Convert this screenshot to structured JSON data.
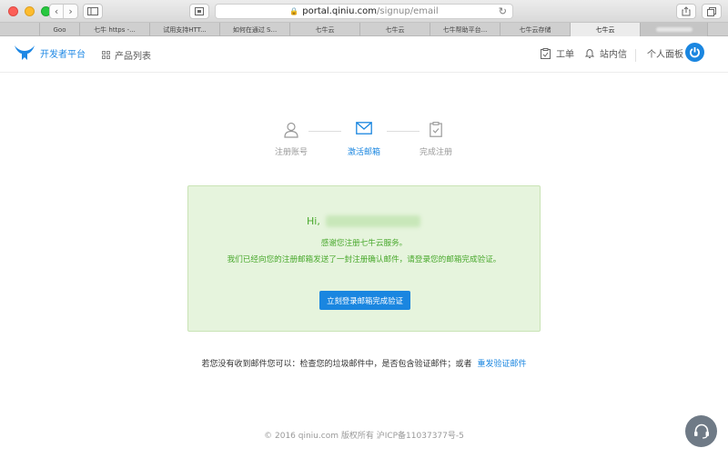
{
  "browser": {
    "url_host": "portal.qiniu.com",
    "url_path": "/signup/email",
    "tabs": [
      {
        "label": "Goo",
        "active": false
      },
      {
        "label": "七牛 https -...",
        "active": false
      },
      {
        "label": "试用支持HTT...",
        "active": false
      },
      {
        "label": "如何在通过 S...",
        "active": false
      },
      {
        "label": "七牛云",
        "active": false
      },
      {
        "label": "七牛云",
        "active": false
      },
      {
        "label": "七牛帮助平台...",
        "active": false
      },
      {
        "label": "七牛云存储",
        "active": false
      },
      {
        "label": "七牛云",
        "active": true
      }
    ]
  },
  "header": {
    "logo_text": "开发者平台",
    "products_label": "产品列表",
    "ticket_label": "工单",
    "messages_label": "站内信",
    "panel_label": "个人面板"
  },
  "steps": [
    {
      "label": "注册账号",
      "state": "done"
    },
    {
      "label": "激活邮箱",
      "state": "current"
    },
    {
      "label": "完成注册",
      "state": "pending"
    }
  ],
  "notice": {
    "greeting": "Hi,",
    "line1": "感谢您注册七牛云服务。",
    "line2": "我们已经向您的注册邮箱发送了一封注册确认邮件，请登录您的邮箱完成验证。",
    "button_label": "立刻登录邮箱完成验证"
  },
  "hint": {
    "text": "若您没有收到邮件您可以：检查您的垃圾邮件中，是否包含验证邮件；或者",
    "link_label": "重发验证邮件"
  },
  "footer": {
    "text": "© 2016 qiniu.com 版权所有 沪ICP备11037377号-5"
  },
  "colors": {
    "accent": "#1a86e0",
    "success_text": "#48a82c",
    "notice_bg": "#e6f4dd"
  }
}
